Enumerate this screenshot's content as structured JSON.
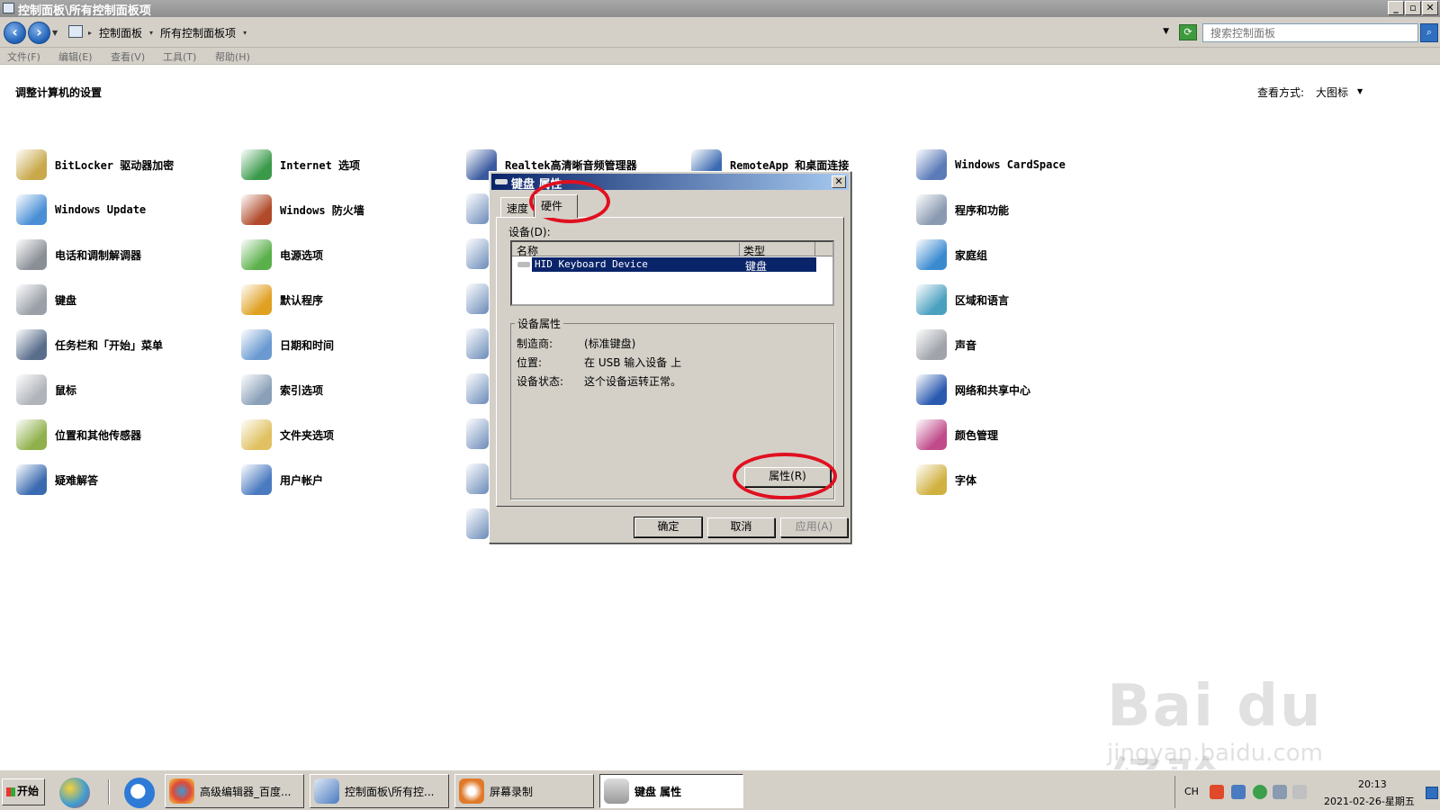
{
  "window": {
    "title": "控制面板\\所有控制面板项",
    "controls": [
      "_",
      "▫",
      "✕"
    ]
  },
  "address": {
    "breadcrumbs": [
      "控制面板",
      "所有控制面板项"
    ],
    "search_placeholder": "搜索控制面板"
  },
  "menu": [
    "文件(F)",
    "编辑(E)",
    "查看(V)",
    "工具(T)",
    "帮助(H)"
  ],
  "content": {
    "title": "调整计算机的设置",
    "view_label": "查看方式:",
    "view_value": "大图标"
  },
  "items": [
    {
      "label": "BitLocker 驱动器加密",
      "icon": "bitlocker-icon",
      "color": "#c8a84a"
    },
    {
      "label": "Windows Update",
      "icon": "windows-update-icon",
      "color": "#4a8fd6"
    },
    {
      "label": "电话和调制解调器",
      "icon": "phone-modem-icon",
      "color": "#8a8f96"
    },
    {
      "label": "键盘",
      "icon": "keyboard-icon",
      "color": "#9aa0a8"
    },
    {
      "label": "任务栏和「开始」菜单",
      "icon": "taskbar-icon",
      "color": "#5a6e8c"
    },
    {
      "label": "鼠标",
      "icon": "mouse-icon",
      "color": "#b0b4ba"
    },
    {
      "label": "位置和其他传感器",
      "icon": "location-sensor-icon",
      "color": "#8fb04a"
    },
    {
      "label": "疑难解答",
      "icon": "troubleshoot-icon",
      "color": "#3a6ab0"
    },
    {
      "label": "Internet 选项",
      "icon": "internet-options-icon",
      "color": "#3a9a4a"
    },
    {
      "label": "Windows 防火墙",
      "icon": "firewall-icon",
      "color": "#b04a2a"
    },
    {
      "label": "电源选项",
      "icon": "power-options-icon",
      "color": "#5ab04a"
    },
    {
      "label": "默认程序",
      "icon": "default-programs-icon",
      "color": "#e0a020"
    },
    {
      "label": "日期和时间",
      "icon": "date-time-icon",
      "color": "#6a9ad0"
    },
    {
      "label": "索引选项",
      "icon": "indexing-icon",
      "color": "#8aa0b8"
    },
    {
      "label": "文件夹选项",
      "icon": "folder-options-icon",
      "color": "#e0c060"
    },
    {
      "label": "用户帐户",
      "icon": "user-accounts-icon",
      "color": "#4a7ac0"
    },
    {
      "label": "Realtek高清晰音频管理器",
      "icon": "realtek-audio-icon",
      "color": "#3a5aa0"
    },
    {
      "label": "RemoteApp 和桌面连接",
      "icon": "remoteapp-icon",
      "color": "#3a6ab0"
    },
    {
      "label": "Windows CardSpace",
      "icon": "cardspace-icon",
      "color": "#5a7ab8"
    },
    {
      "label": "程序和功能",
      "icon": "programs-features-icon",
      "color": "#8a9ab0"
    },
    {
      "label": "家庭组",
      "icon": "homegroup-icon",
      "color": "#3a8ad0"
    },
    {
      "label": "区域和语言",
      "icon": "region-language-icon",
      "color": "#4aa0c0"
    },
    {
      "label": "声音",
      "icon": "sound-icon",
      "color": "#a0a4aa"
    },
    {
      "label": "网络和共享中心",
      "icon": "network-sharing-icon",
      "color": "#2a5ab0"
    },
    {
      "label": "颜色管理",
      "icon": "color-management-icon",
      "color": "#c04a8a"
    },
    {
      "label": "字体",
      "icon": "fonts-icon",
      "color": "#d0b040"
    }
  ],
  "partial_icons": [
    "sound-settings-icon",
    "sync-center-icon",
    "monitor-icon",
    "credential-icon",
    "device-manager-icon",
    "display-icon",
    "speech-icon",
    "system-icon"
  ],
  "dialog": {
    "title": "键盘 属性",
    "tabs": [
      "速度",
      "硬件"
    ],
    "devices_label": "设备(D):",
    "columns": [
      "名称",
      "类型"
    ],
    "devices": [
      {
        "name": "HID Keyboard Device",
        "type": "键盘"
      }
    ],
    "props_group": "设备属性",
    "props": [
      {
        "key": "制造商:",
        "value": "(标准键盘)"
      },
      {
        "key": "位置:",
        "value": "在 USB 输入设备 上"
      },
      {
        "key": "设备状态:",
        "value": "这个设备运转正常。"
      }
    ],
    "buttons": {
      "properties": "属性(R)",
      "ok": "确定",
      "cancel": "取消",
      "apply": "应用(A)"
    }
  },
  "taskbar": {
    "start": "开始",
    "tasks": [
      {
        "label": "高级编辑器_百度...",
        "icon": "chrome-icon"
      },
      {
        "label": "控制面板\\所有控...",
        "icon": "control-panel-icon"
      },
      {
        "label": "屏幕录制",
        "icon": "screen-record-icon"
      },
      {
        "label": "键盘 属性",
        "icon": "keyboard-icon"
      }
    ],
    "tray": {
      "lang": "CH",
      "time": "20:13",
      "date": "2021-02-26-星期五"
    }
  },
  "watermark": {
    "big": "Bai du 经验",
    "small": "jingyan.baidu.com"
  },
  "colors": {
    "annotation": "#e01020",
    "selection": "#0a246a",
    "face": "#d4d0c8"
  }
}
